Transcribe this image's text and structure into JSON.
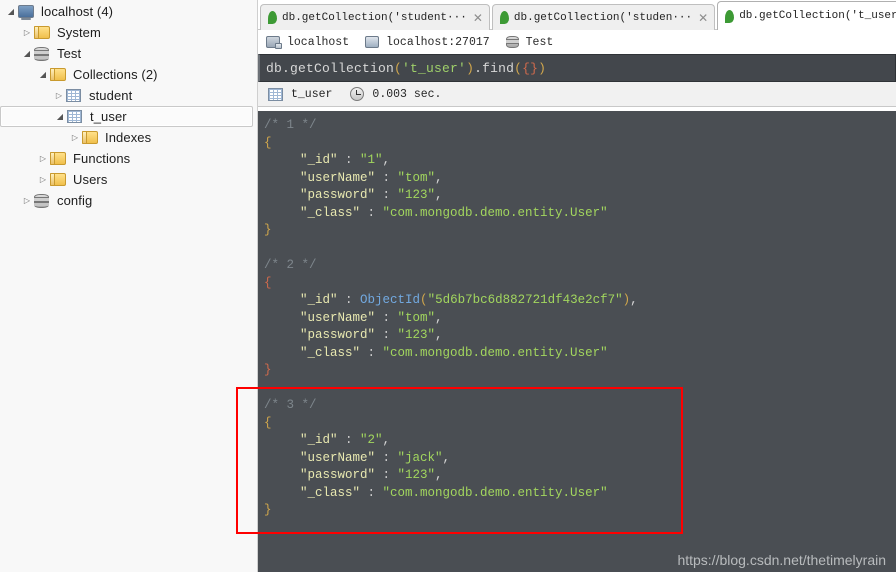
{
  "sidebar": {
    "tree": [
      {
        "label": "localhost (4)",
        "icon": "server-icon",
        "indent": 0,
        "twisty": "expanded",
        "selected": false
      },
      {
        "label": "System",
        "icon": "folder-icon",
        "indent": 1,
        "twisty": "collapsed",
        "selected": false
      },
      {
        "label": "Test",
        "icon": "database-icon",
        "indent": 1,
        "twisty": "expanded",
        "selected": false
      },
      {
        "label": "Collections (2)",
        "icon": "folder-icon",
        "indent": 2,
        "twisty": "expanded",
        "selected": false
      },
      {
        "label": "student",
        "icon": "collection-icon",
        "indent": 3,
        "twisty": "collapsed",
        "selected": false
      },
      {
        "label": "t_user",
        "icon": "collection-icon",
        "indent": 3,
        "twisty": "expanded",
        "selected": true
      },
      {
        "label": "Indexes",
        "icon": "folder-icon",
        "indent": 4,
        "twisty": "collapsed",
        "selected": false
      },
      {
        "label": "Functions",
        "icon": "folder-icon",
        "indent": 2,
        "twisty": "collapsed",
        "selected": false
      },
      {
        "label": "Users",
        "icon": "folder-icon",
        "indent": 2,
        "twisty": "collapsed",
        "selected": false
      },
      {
        "label": "config",
        "icon": "database-icon",
        "indent": 1,
        "twisty": "collapsed",
        "selected": false
      }
    ]
  },
  "tabs": [
    {
      "title": "db.getCollection('student···",
      "active": false,
      "close": "✕"
    },
    {
      "title": "db.getCollection('studen···",
      "active": false,
      "close": "✕"
    },
    {
      "title": "db.getCollection('t_user'···",
      "active": true,
      "close": "✕"
    }
  ],
  "breadcrumb": {
    "connection": "localhost",
    "host": "localhost:27017",
    "database": "Test"
  },
  "editor": {
    "t1": "db.getCollection",
    "t2": "(",
    "t3": "'t_user'",
    "t4": ")",
    "t5": ".find",
    "t6": "(",
    "t7": "{}",
    "t8": ")"
  },
  "result_toolbar": {
    "collection": "t_user",
    "time": "0.003 sec."
  },
  "results": {
    "documents": [
      {
        "comment": "/* 1 */",
        "open": "{",
        "close": "}",
        "fields": [
          {
            "key": "\"_id\"",
            "value": "\"1\"",
            "type": "string",
            "comma": ","
          },
          {
            "key": "\"userName\"",
            "value": "\"tom\"",
            "type": "string",
            "comma": ","
          },
          {
            "key": "\"password\"",
            "value": "\"123\"",
            "type": "string",
            "comma": ","
          },
          {
            "key": "\"_class\"",
            "value": "\"com.mongodb.demo.entity.User\"",
            "type": "string",
            "comma": ""
          }
        ]
      },
      {
        "comment": "/* 2 */",
        "open": "{",
        "close": "}",
        "fields": [
          {
            "key": "\"_id\"",
            "fn": "ObjectId",
            "value": "\"5d6b7bc6d882721df43e2cf7\"",
            "type": "objectid",
            "comma": ","
          },
          {
            "key": "\"userName\"",
            "value": "\"tom\"",
            "type": "string",
            "comma": ","
          },
          {
            "key": "\"password\"",
            "value": "\"123\"",
            "type": "string",
            "comma": ","
          },
          {
            "key": "\"_class\"",
            "value": "\"com.mongodb.demo.entity.User\"",
            "type": "string",
            "comma": ""
          }
        ]
      },
      {
        "comment": "/* 3 */",
        "open": "{",
        "close": "}",
        "highlighted": true,
        "fields": [
          {
            "key": "\"_id\"",
            "value": "\"2\"",
            "type": "string",
            "comma": ","
          },
          {
            "key": "\"userName\"",
            "value": "\"jack\"",
            "type": "string",
            "comma": ","
          },
          {
            "key": "\"password\"",
            "value": "\"123\"",
            "type": "string",
            "comma": ","
          },
          {
            "key": "\"_class\"",
            "value": "\"com.mongodb.demo.entity.User\"",
            "type": "string",
            "comma": ""
          }
        ]
      }
    ]
  },
  "annotation": {
    "color": "#ff0000"
  },
  "watermark": {
    "text": "https://blog.csdn.net/thetimelyrain"
  }
}
